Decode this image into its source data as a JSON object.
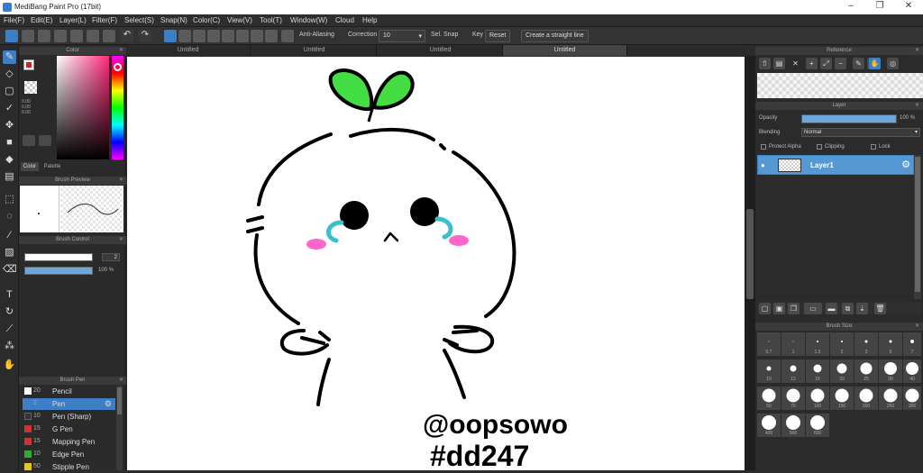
{
  "window": {
    "title": "MediBang Paint Pro (17bit)",
    "min": "–",
    "max": "❐",
    "close": "✕"
  },
  "menu": [
    "File(F)",
    "Edit(E)",
    "Layer(L)",
    "Filter(F)",
    "Select(S)",
    "Snap(N)",
    "Color(C)",
    "View(V)",
    "Tool(T)",
    "Window(W)",
    "Cloud",
    "Help"
  ],
  "toolbar": {
    "antialias": "Anti-Aliasing",
    "correction_label": "Correction",
    "correction_value": "10",
    "snap_label": "Sel. Snap",
    "key_label": "Key",
    "reset": "Reset",
    "straight_line": "Create a straight line"
  },
  "tabs": [
    "Untitled",
    "Untitled",
    "Untitled",
    "Untitled"
  ],
  "left": {
    "color_title": "Color",
    "color_tab": "Color",
    "palette_tab": "Palette",
    "hex_values": "0.00\n0.00\n0.00",
    "brush_preview_title": "Brush Preview",
    "brush_control_title": "Brush Control",
    "size_value": "2",
    "opacity_value": "100 %",
    "brush_title": "Brush Pen",
    "brushes": [
      {
        "size": "20",
        "name": "Pencil",
        "color": "#ffffff"
      },
      {
        "size": "2",
        "name": "Pen",
        "color": "#3d7fc7"
      },
      {
        "size": "10",
        "name": "Pen (Sharp)",
        "color": "#333333"
      },
      {
        "size": "15",
        "name": "G Pen",
        "color": "#cc3333"
      },
      {
        "size": "15",
        "name": "Mapping Pen",
        "color": "#cc3333"
      },
      {
        "size": "10",
        "name": "Edge Pen",
        "color": "#33aa33"
      },
      {
        "size": "50",
        "name": "Stipple Pen",
        "color": "#e6c619"
      }
    ]
  },
  "canvas": {
    "signature_line1": "@oopsowo",
    "signature_line2": "#dd247"
  },
  "right": {
    "reference_title": "Reference",
    "layer_title": "Layer",
    "opacity_label": "Opacity",
    "opacity_value": "100 %",
    "blending_label": "Blending",
    "blending_value": "Normal",
    "protect_alpha": "Protect Alpha",
    "clipping": "Clipping",
    "lock": "Lock",
    "layer_name": "Layer1",
    "brush_size_title": "Brush Size",
    "brush_sizes": [
      "0.7",
      "1",
      "1.5",
      "2",
      "3",
      "5",
      "7",
      "10",
      "12",
      "15",
      "20",
      "25",
      "30",
      "40",
      "50",
      "70",
      "100",
      "150",
      "200",
      "250",
      "300",
      "400",
      "500",
      "600"
    ]
  }
}
